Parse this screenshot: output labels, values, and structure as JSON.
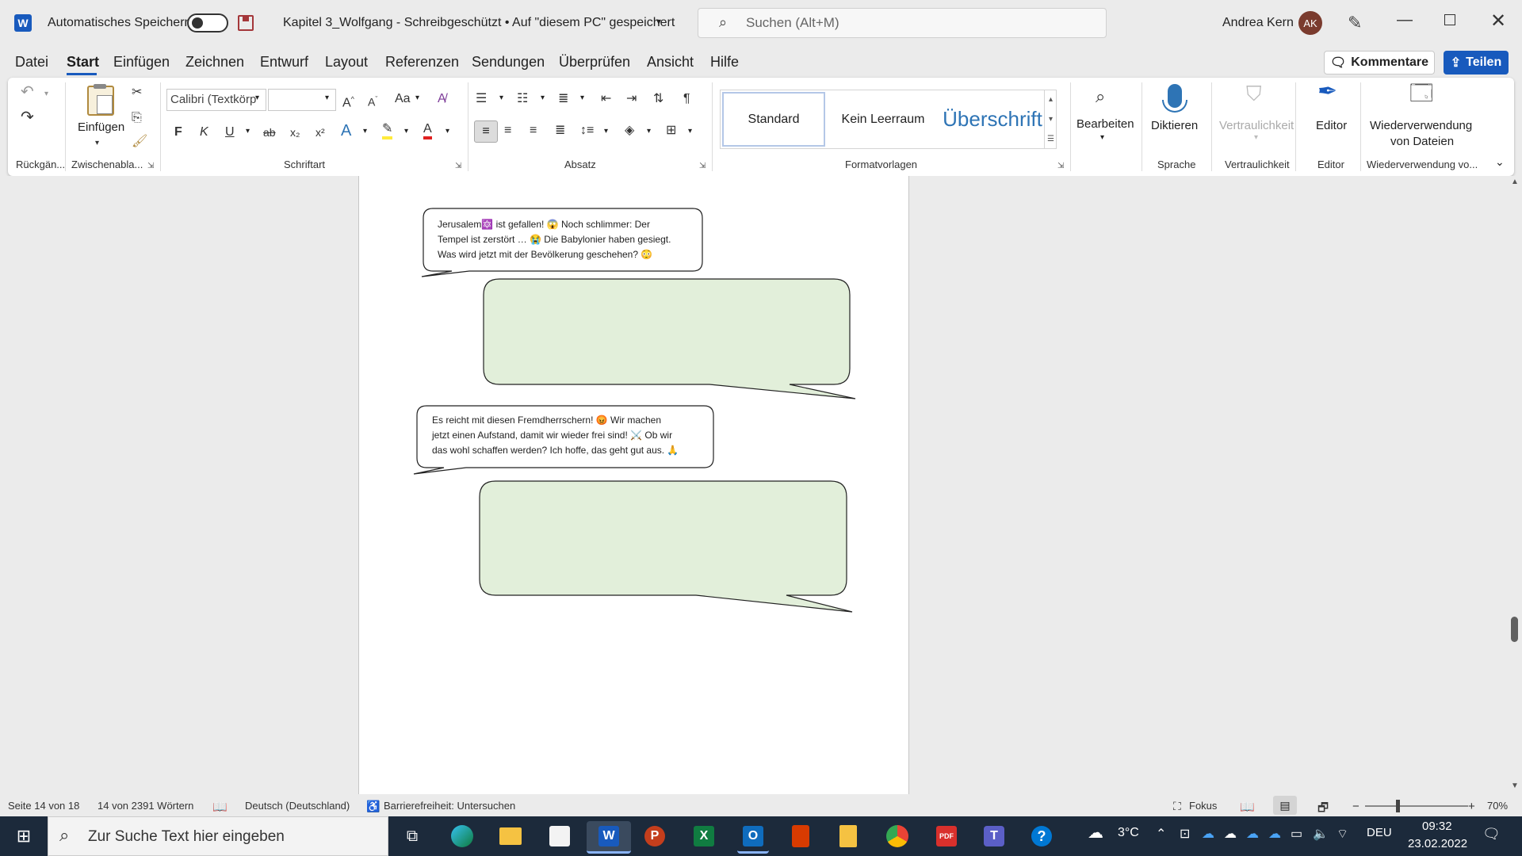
{
  "window": {
    "autosave_label": "Automatisches Speichern",
    "doc_title": "Kapitel 3_Wolfgang  -  Schreibgeschützt • Auf \"diesem PC\" gespeichert",
    "search_placeholder": "Suchen (Alt+M)",
    "user_name": "Andrea Kern",
    "user_initials": "AK"
  },
  "menu": {
    "tabs": [
      "Datei",
      "Start",
      "Einfügen",
      "Zeichnen",
      "Entwurf",
      "Layout",
      "Referenzen",
      "Sendungen",
      "Überprüfen",
      "Ansicht",
      "Hilfe"
    ],
    "active_tab": "Start",
    "comments_label": "Kommentare",
    "share_label": "Teilen"
  },
  "ribbon": {
    "groups": {
      "undo": "Rückgän...",
      "clipboard": "Zwischenabla...",
      "font": "Schriftart",
      "paragraph": "Absatz",
      "styles": "Formatvorlagen",
      "voice": "Sprache",
      "sensitivity": "Vertraulichkeit",
      "editor": "Editor",
      "reuse": "Wiederverwendung vo..."
    },
    "paste_label": "Einfügen",
    "font_name": "Calibri (Textkörp",
    "font_size": "",
    "bold": "F",
    "italic": "K",
    "underline": "U",
    "strike": "ab",
    "subscript": "x₂",
    "superscript": "x²",
    "change_case": "Aa",
    "styles": [
      "Standard",
      "Kein Leerraum",
      "Überschrift"
    ],
    "edit_label": "Bearbeiten",
    "dictate_label": "Diktieren",
    "sensitivity_label": "Vertraulichkeit",
    "editor_label": "Editor",
    "reuse_label_1": "Wiederverwendung",
    "reuse_label_2": "von Dateien"
  },
  "document": {
    "bubble1": [
      "Jerusalem🔯 ist gefallen! 😱 Noch schlimmer: Der",
      "Tempel ist zerstört … 😭 Die Babylonier haben gesiegt.",
      "Was wird jetzt mit der Bevölkerung geschehen? 😳"
    ],
    "bubble2": [
      "Es reicht mit diesen Fremdherrschern! 😡 Wir machen",
      "jetzt einen Aufstand, damit wir wieder frei sind! ⚔️ Ob wir",
      "das wohl schaffen werden? Ich hoffe, das geht gut aus. 🙏"
    ],
    "reply_fill": "#e2efda"
  },
  "status": {
    "page": "Seite 14 von 18",
    "words": "14 von 2391 Wörtern",
    "language": "Deutsch (Deutschland)",
    "accessibility": "Barrierefreiheit: Untersuchen",
    "focus": "Fokus",
    "zoom": "70%"
  },
  "taskbar": {
    "search_placeholder": "Zur Suche Text hier eingeben",
    "temperature": "3°C",
    "keyboard": "DEU",
    "time": "09:32",
    "date": "23.02.2022"
  },
  "colors": {
    "accent": "#185abd",
    "word_blue": "#185abd",
    "taskbar": "#1c2a3b"
  }
}
